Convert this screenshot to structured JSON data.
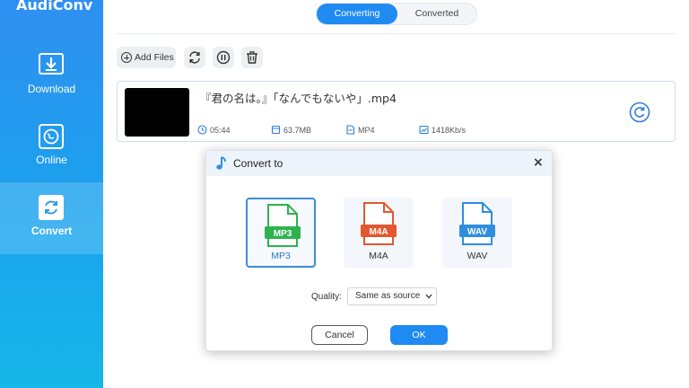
{
  "app": {
    "title": "AudiConv"
  },
  "sidebar": {
    "items": [
      {
        "label": "Download",
        "icon": "download-icon"
      },
      {
        "label": "Online",
        "icon": "globe-icon"
      },
      {
        "label": "Convert",
        "icon": "convert-icon",
        "active": true
      }
    ]
  },
  "tabs": [
    {
      "label": "Converting",
      "active": true
    },
    {
      "label": "Converted",
      "active": false
    }
  ],
  "toolbar": {
    "add_files_label": "Add Files",
    "icons": [
      "refresh-icon",
      "pause-icon",
      "trash-icon"
    ]
  },
  "file": {
    "name": "『君の名は。』「なんでもないや」.mp4",
    "duration": "05:44",
    "size": "63.7MB",
    "format": "MP4",
    "bitrate": "1418Kb/s"
  },
  "dialog": {
    "title": "Convert to",
    "formats": [
      {
        "badge": "MP3",
        "label": "MP3",
        "color": "#2eb24e",
        "selected": true
      },
      {
        "badge": "M4A",
        "label": "M4A",
        "color": "#e4572e",
        "selected": false
      },
      {
        "badge": "WAV",
        "label": "WAV",
        "color": "#2f8de0",
        "selected": false
      }
    ],
    "quality_label": "Quality:",
    "quality_value": "Same as source",
    "cancel_label": "Cancel",
    "ok_label": "OK"
  },
  "colors": {
    "accent": "#1f8af2",
    "sidebar_top": "#2f8ff0",
    "sidebar_bottom": "#17b7e8"
  }
}
